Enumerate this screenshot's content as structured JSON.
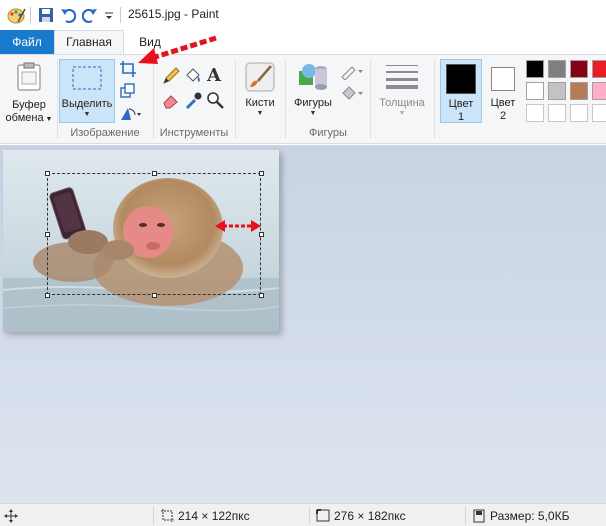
{
  "window": {
    "title": "25615.jpg - Paint"
  },
  "menu": {
    "file": "Файл",
    "home": "Главная",
    "view": "Вид"
  },
  "ribbon": {
    "clipboard": {
      "label_line1": "Буфер",
      "label_line2": "обмена"
    },
    "image": {
      "select_label": "Выделить",
      "group": "Изображение"
    },
    "tools": {
      "group": "Инструменты",
      "text_tool": "A"
    },
    "brushes": {
      "label": "Кисти"
    },
    "shapes": {
      "label": "Фигуры",
      "group": "Фигуры"
    },
    "size": {
      "label": "Толщина"
    },
    "color1": {
      "line1": "Цвет",
      "line2": "1"
    },
    "color2": {
      "line1": "Цвет",
      "line2": "2"
    },
    "palette": [
      "#000000",
      "#7f7f7f",
      "#880015",
      "#ed1c24",
      "#ffffff",
      "#c3c3c3",
      "#b97a57",
      "#ffaec9"
    ],
    "primary_color": "#000000",
    "secondary_color": "#ffffff"
  },
  "status": {
    "selection_size": "214 × 122пкс",
    "image_size": "276 × 182пкс",
    "file_size": "Размер: 5,0КБ"
  },
  "colors": {
    "accent": "#1979ca",
    "annotation": "#e8101a"
  }
}
